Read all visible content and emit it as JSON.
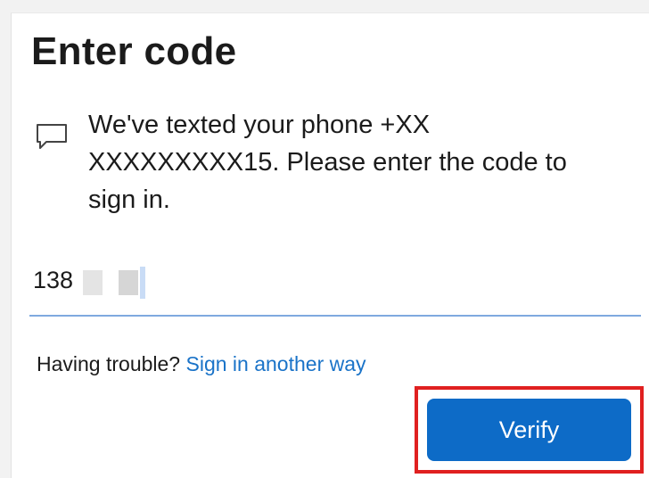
{
  "dialog": {
    "title": "Enter code",
    "message_line1": "We've texted your phone +XX",
    "message_line2": "XXXXXXXXX15. Please enter the code to",
    "message_line3": "sign in.",
    "message_icon": "chat-bubble-icon"
  },
  "code_input": {
    "value": "138"
  },
  "help": {
    "prefix": "Having trouble?",
    "link_label": "Sign in another way"
  },
  "actions": {
    "verify_label": "Verify"
  },
  "colors": {
    "accent": "#0d6bc7",
    "link": "#1a73c8",
    "highlight": "#e02020",
    "input_underline": "#7fa9df"
  }
}
